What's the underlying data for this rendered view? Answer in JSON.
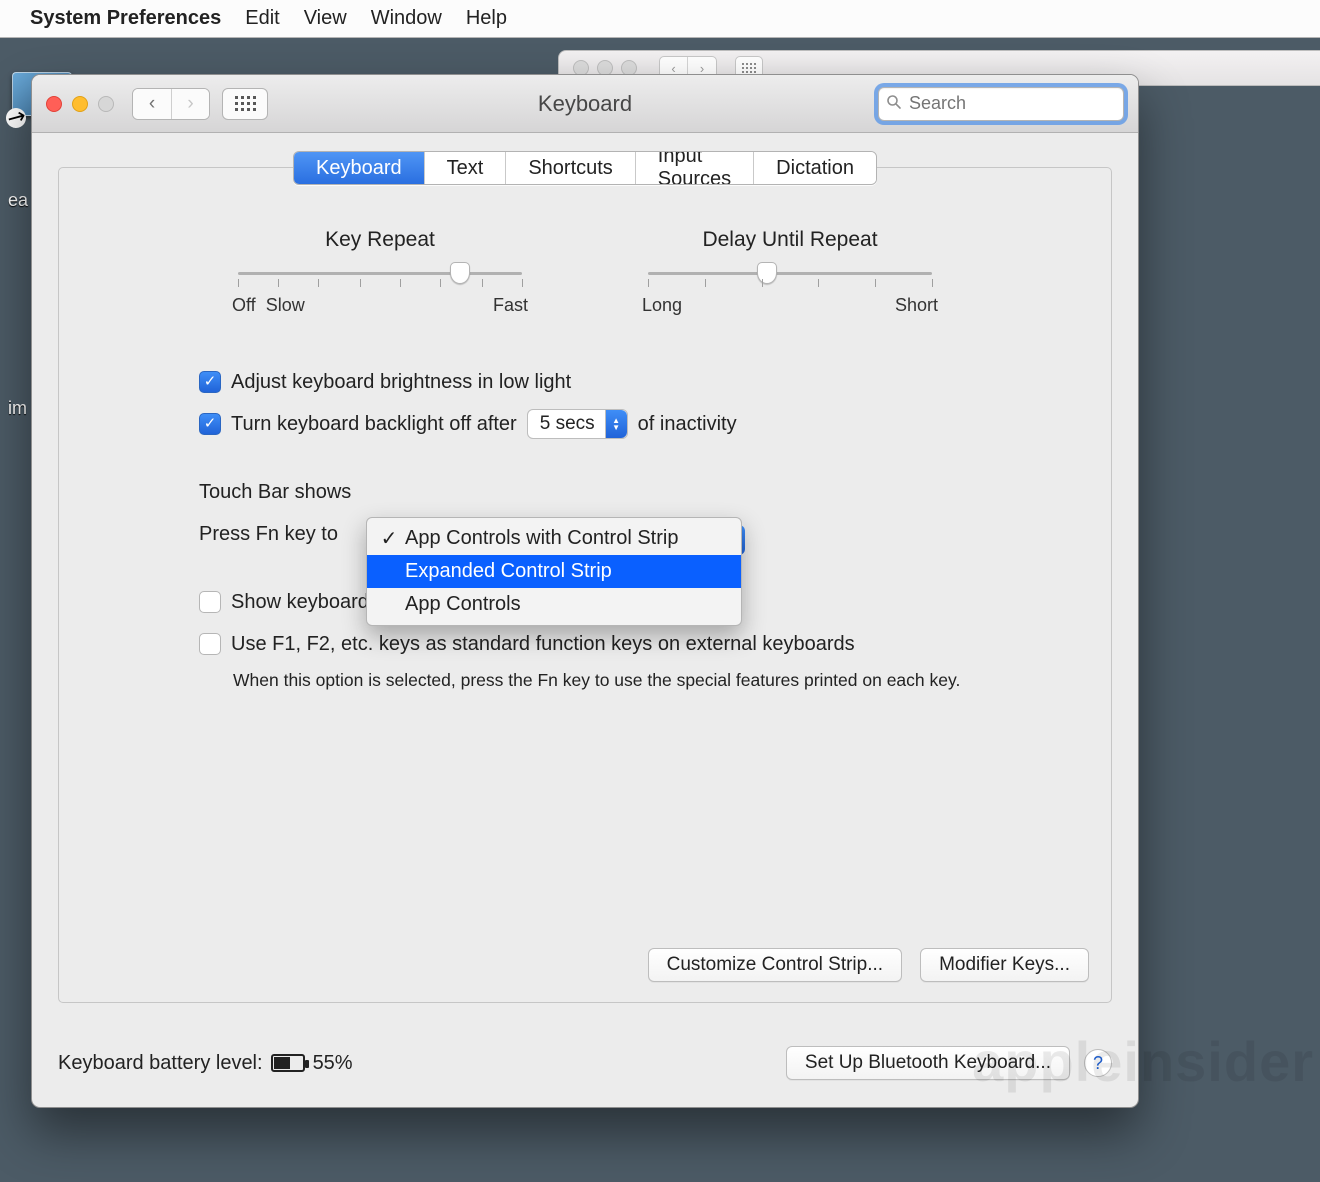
{
  "menubar": {
    "app": "System Preferences",
    "items": [
      "Edit",
      "View",
      "Window",
      "Help"
    ]
  },
  "desktop": {
    "label_top": "ea",
    "label_bottom": "im"
  },
  "window": {
    "title": "Keyboard",
    "search_placeholder": "Search"
  },
  "tabs": [
    "Keyboard",
    "Text",
    "Shortcuts",
    "Input Sources",
    "Dictation"
  ],
  "tabs_active_index": 0,
  "sliders": {
    "key_repeat": {
      "title": "Key Repeat",
      "left": "Off",
      "left2": "Slow",
      "right": "Fast"
    },
    "delay_repeat": {
      "title": "Delay Until Repeat",
      "left": "Long",
      "right": "Short"
    }
  },
  "checkboxes": {
    "auto_brightness": {
      "checked": true,
      "label": "Adjust keyboard brightness in low light"
    },
    "backlight_off": {
      "checked": true,
      "label_before": "Turn keyboard backlight off after",
      "value": "5 secs",
      "label_after": "of inactivity"
    },
    "show_emoji": {
      "checked": false,
      "label": "Show keyboard and emoji viewers in menu bar"
    },
    "fn_keys": {
      "checked": false,
      "label": "Use F1, F2, etc. keys as standard function keys on external keyboards",
      "note": "When this option is selected, press the Fn key to use the special features printed on each key."
    }
  },
  "touchbar": {
    "label_shows": "Touch Bar shows",
    "label_fn": "Press Fn key to",
    "options": [
      "App Controls with Control Strip",
      "Expanded Control Strip",
      "App Controls"
    ],
    "selected_index": 0,
    "highlight_index": 1
  },
  "buttons": {
    "customize": "Customize Control Strip...",
    "modifier": "Modifier Keys...",
    "bluetooth": "Set Up Bluetooth Keyboard..."
  },
  "footer": {
    "battery_label": "Keyboard battery level:",
    "battery_pct": "55%"
  },
  "watermark": "appleinsider"
}
